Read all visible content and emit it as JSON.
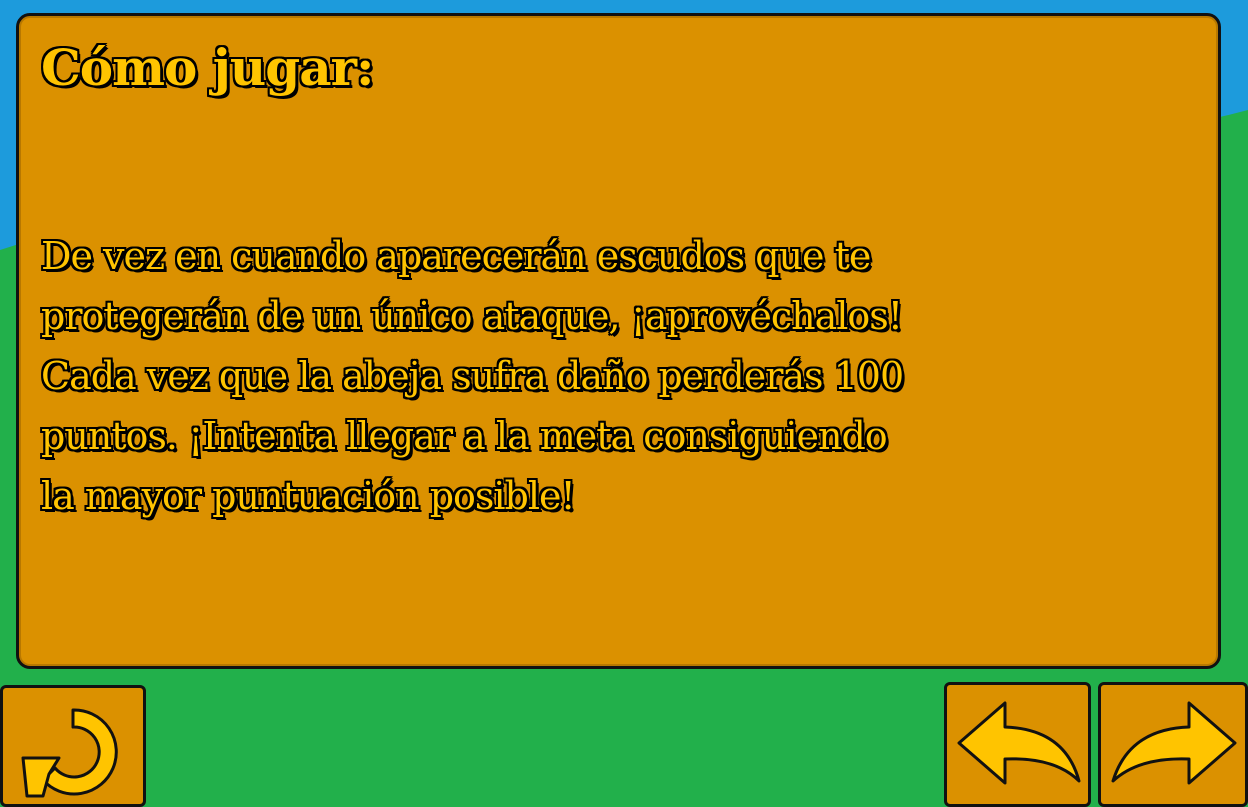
{
  "panel": {
    "title": "Cómo jugar:",
    "body_lines": [
      "De vez en cuando aparecerán escudos que te",
      "protegerán de un único ataque, ¡aprovéchalos!",
      "Cada vez que la abeja sufra daño perderás 100",
      "puntos. ¡Intenta llegar a la meta consiguiendo",
      "la mayor puntuación posible!"
    ]
  },
  "buttons": {
    "restart_icon": "restart-arrow-icon",
    "back_icon": "curved-left-arrow-icon",
    "next_icon": "curved-right-arrow-icon"
  },
  "colors": {
    "sky": "#1d9bdc",
    "grass": "#22b04b",
    "panel": "#db9100",
    "text_fill": "#ffc400",
    "outline": "#111111"
  }
}
